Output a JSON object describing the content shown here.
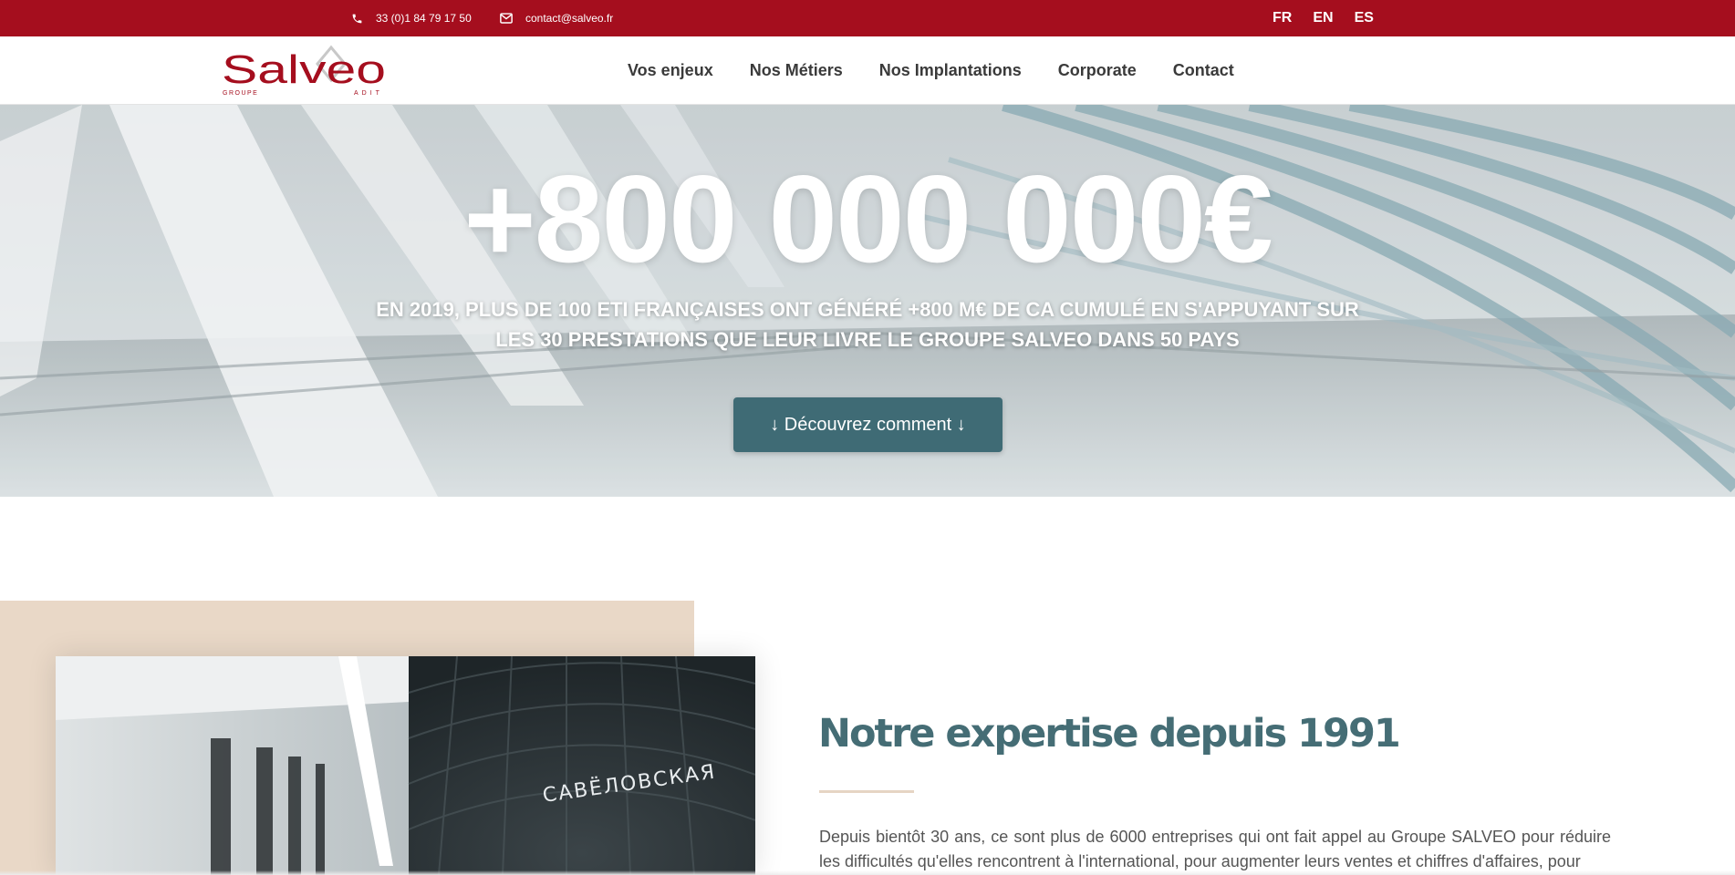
{
  "topbar": {
    "phone": "33 (0)1 84 79 17 50",
    "email": "contact@salveo.fr",
    "languages": [
      "FR",
      "EN",
      "ES"
    ]
  },
  "header": {
    "logo_text": "Salveo",
    "logo_sub_left": "GROUPE",
    "logo_sub_right": "ADIT",
    "nav": [
      "Vos enjeux",
      "Nos Métiers",
      "Nos Implantations",
      "Corporate",
      "Contact"
    ]
  },
  "hero": {
    "title": "+800 000 000€",
    "subtitle": "EN 2019, PLUS DE 100 ETI FRANÇAISES ONT GÉNÉRÉ +800 M€ DE CA CUMULÉ EN S'APPUYANT SUR LES 30 PRESTATIONS QUE LEUR LIVRE LE GROUPE SALVEO DANS 50 PAYS",
    "cta": "↓ Découvrez comment ↓"
  },
  "expertise": {
    "title": "Notre expertise depuis 1991",
    "body": "Depuis bientôt 30 ans, ce sont plus de 6000 entreprises qui ont fait appel au Groupe SALVEO pour réduire les difficultés qu'elles rencontrent à l'international, pour augmenter leurs ventes et chiffres d'affaires, pour",
    "photo_sign": "САВЁЛОВСКАЯ"
  },
  "colors": {
    "brand_red": "#a50e1e",
    "accent_teal": "#3f6b75",
    "beige": "#e9d8c7"
  }
}
